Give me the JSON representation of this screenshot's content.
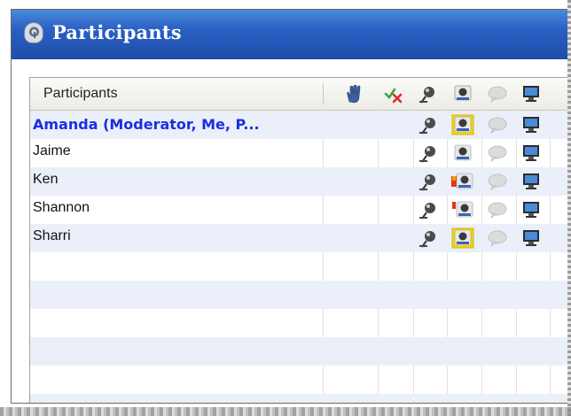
{
  "window": {
    "title": "Participants"
  },
  "grid": {
    "header": {
      "label": "Participants",
      "icons": [
        "raise-hand-icon",
        "approve-deny-icon",
        "microphone-icon",
        "webcam-icon",
        "chat-icon",
        "desktop-share-icon"
      ]
    },
    "rows": [
      {
        "name": "Amanda (Moderator, Me, P...",
        "is_me": true,
        "mic": true,
        "camera": "active",
        "chat": true,
        "desktop": true
      },
      {
        "name": "Jaime",
        "is_me": false,
        "mic": true,
        "camera": "plain",
        "chat": true,
        "desktop": true
      },
      {
        "name": "Ken",
        "is_me": false,
        "mic": true,
        "camera": "recording",
        "chat": true,
        "desktop": true
      },
      {
        "name": "Shannon",
        "is_me": false,
        "mic": true,
        "camera": "recording-small",
        "chat": true,
        "desktop": true
      },
      {
        "name": "Sharri",
        "is_me": false,
        "mic": true,
        "camera": "active",
        "chat": true,
        "desktop": true
      }
    ],
    "empty_rows": 6
  },
  "colors": {
    "title_bar": "#2a5fc4",
    "moderator_text": "#1a2fe0",
    "row_alt": "#ebeff9",
    "camera_highlight": "#f7d600"
  }
}
